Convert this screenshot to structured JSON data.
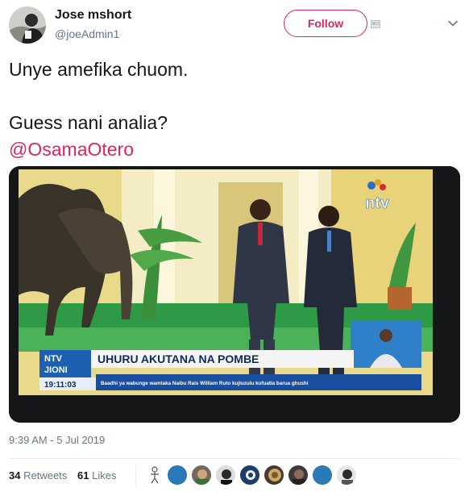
{
  "user": {
    "display_name": "Jose mshort",
    "handle": "@joeAdmin1",
    "follow_label": "Follow"
  },
  "tweet": {
    "line1": "Unye amefika chuom.",
    "line2": "Guess nani analia?",
    "mention": "@OsamaOtero",
    "timestamp": "9:39 AM - 5 Jul 2019"
  },
  "media": {
    "channel_logo": "ntv",
    "program_badge": "NTV JIONI",
    "program_line1": "NTV",
    "program_line2": "JIONI",
    "clock": "19:11:03",
    "headline": "UHURU AKUTANA NA POMBE",
    "ticker": "Baadhi ya wabunge wamtaka Naibu Rais William Ruto kujiuzulu kufuatia barua ghushi"
  },
  "stats": {
    "retweets_count": "34",
    "retweets_label": "Retweets",
    "likes_count": "61",
    "likes_label": "Likes"
  },
  "colors": {
    "accent": "#e0245e",
    "secondary_text": "#657786",
    "primary_text": "#14171a"
  },
  "icons": {
    "card": "card-icon",
    "chevron": "chevron-down-icon"
  }
}
